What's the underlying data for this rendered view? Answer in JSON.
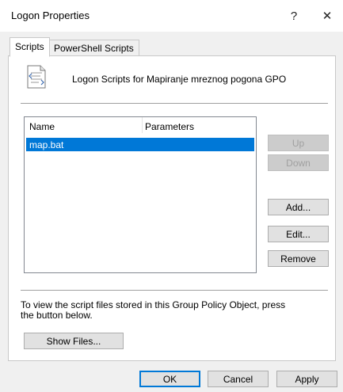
{
  "window": {
    "title": "Logon Properties",
    "help_glyph": "?",
    "close_glyph": "✕"
  },
  "tabs": [
    {
      "label": "Scripts",
      "active": true
    },
    {
      "label": "PowerShell Scripts",
      "active": false
    }
  ],
  "scripts": {
    "heading": "Logon Scripts for Mapiranje mreznog pogona GPO",
    "columns": [
      "Name",
      "Parameters"
    ],
    "rows": [
      {
        "name": "map.bat",
        "parameters": "",
        "selected": true
      }
    ],
    "buttons": {
      "up": "Up",
      "down": "Down",
      "add": "Add...",
      "edit": "Edit...",
      "remove": "Remove"
    },
    "note": "To view the script files stored in this Group Policy Object, press the button below.",
    "show_files": "Show Files..."
  },
  "footer": {
    "ok": "OK",
    "cancel": "Cancel",
    "apply": "Apply"
  },
  "colors": {
    "selection": "#0078d7",
    "window_bg": "#f0f0f0"
  },
  "icons": {
    "script": "script-document-icon"
  }
}
